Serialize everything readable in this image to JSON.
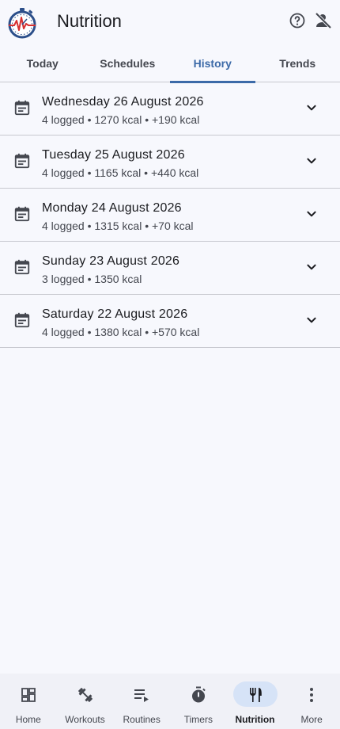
{
  "header": {
    "title": "Nutrition",
    "logo_icon": "stopwatch-heartbeat-logo",
    "actions": [
      {
        "icon": "help-circle-icon"
      },
      {
        "icon": "account-off-icon"
      }
    ]
  },
  "tabs": [
    {
      "label": "Today",
      "active": false
    },
    {
      "label": "Schedules",
      "active": false
    },
    {
      "label": "History",
      "active": true
    },
    {
      "label": "Trends",
      "active": false
    }
  ],
  "history": [
    {
      "date": "Wednesday 26 August 2026",
      "summary": "4 logged • 1270 kcal • +190 kcal"
    },
    {
      "date": "Tuesday 25 August 2026",
      "summary": "4 logged • 1165 kcal • +440 kcal"
    },
    {
      "date": "Monday 24 August 2026",
      "summary": "4 logged • 1315 kcal • +70 kcal"
    },
    {
      "date": "Sunday 23 August 2026",
      "summary": "3 logged • 1350 kcal"
    },
    {
      "date": "Saturday 22 August 2026",
      "summary": "4 logged • 1380 kcal • +570 kcal"
    }
  ],
  "bottom_nav": [
    {
      "label": "Home",
      "icon": "dashboard-icon",
      "active": false
    },
    {
      "label": "Workouts",
      "icon": "dumbbell-icon",
      "active": false
    },
    {
      "label": "Routines",
      "icon": "playlist-play-icon",
      "active": false
    },
    {
      "label": "Timers",
      "icon": "timer-icon",
      "active": false
    },
    {
      "label": "Nutrition",
      "icon": "fork-knife-icon",
      "active": true
    },
    {
      "label": "More",
      "icon": "more-vertical-icon",
      "active": false
    }
  ],
  "colors": {
    "accent": "#3c6aa8",
    "background": "#f7f8fd",
    "active_nav_pill": "#d6e3f7",
    "divider": "#c7c8cf"
  }
}
